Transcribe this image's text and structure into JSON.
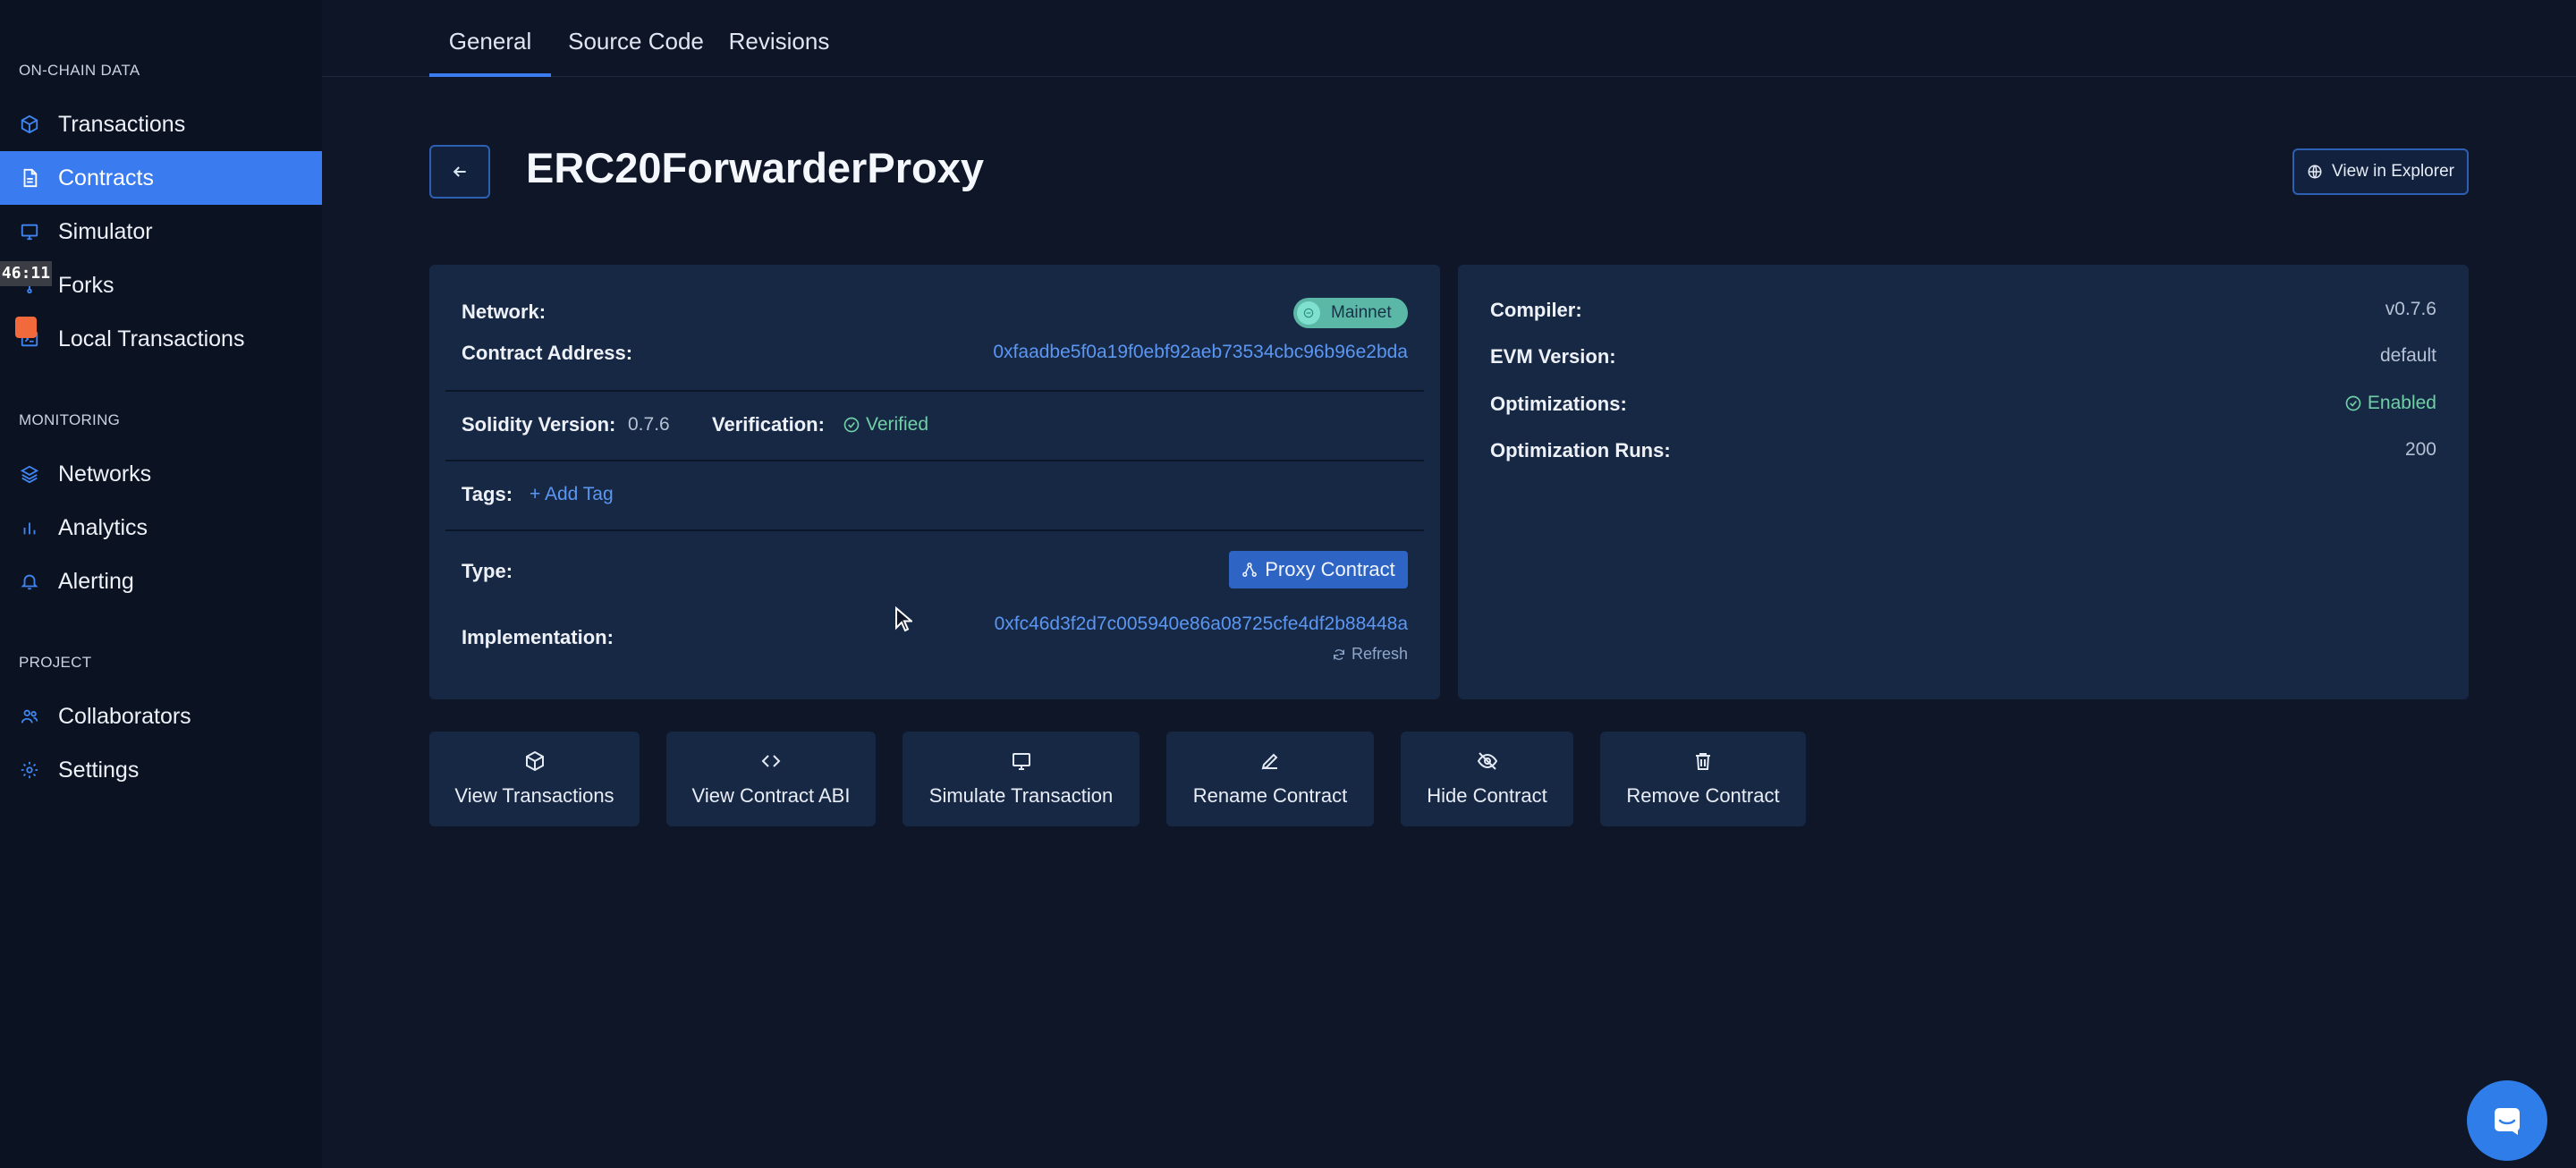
{
  "sidebar": {
    "sections": [
      {
        "title": "ON-CHAIN DATA",
        "items": [
          {
            "label": "Transactions",
            "icon": "cube-icon"
          },
          {
            "label": "Contracts",
            "icon": "document-icon",
            "active": true
          },
          {
            "label": "Simulator",
            "icon": "monitor-icon"
          },
          {
            "label": "Forks",
            "icon": "fork-icon"
          },
          {
            "label": "Local Transactions",
            "icon": "terminal-icon"
          }
        ]
      },
      {
        "title": "MONITORING",
        "items": [
          {
            "label": "Networks",
            "icon": "layers-icon"
          },
          {
            "label": "Analytics",
            "icon": "bar-chart-icon"
          },
          {
            "label": "Alerting",
            "icon": "bell-icon"
          }
        ]
      },
      {
        "title": "PROJECT",
        "items": [
          {
            "label": "Collaborators",
            "icon": "users-icon"
          },
          {
            "label": "Settings",
            "icon": "gear-icon"
          }
        ]
      }
    ],
    "recording_timer": "46:11"
  },
  "tabs": [
    {
      "label": "General",
      "active": true
    },
    {
      "label": "Source Code"
    },
    {
      "label": "Revisions"
    }
  ],
  "header": {
    "title": "ERC20ForwarderProxy",
    "explorer_label": "View in Explorer"
  },
  "contract": {
    "network_label": "Network:",
    "network_value": "Mainnet",
    "address_label": "Contract Address:",
    "address_value": "0xfaadbe5f0a19f0ebf92aeb73534cbc96b96e2bda",
    "solidity_label": "Solidity Version:",
    "solidity_value": "0.7.6",
    "verification_label": "Verification:",
    "verification_value": "Verified",
    "tags_label": "Tags:",
    "add_tag_label": "+ Add Tag",
    "type_label": "Type:",
    "type_value": "Proxy Contract",
    "implementation_label": "Implementation:",
    "implementation_value": "0xfc46d3f2d7c005940e86a08725cfe4df2b88448a",
    "refresh_label": "Refresh"
  },
  "compiler": {
    "compiler_label": "Compiler:",
    "compiler_value": "v0.7.6",
    "evm_label": "EVM Version:",
    "evm_value": "default",
    "optimizations_label": "Optimizations:",
    "optimizations_value": "Enabled",
    "runs_label": "Optimization Runs:",
    "runs_value": "200"
  },
  "actions": [
    {
      "label": "View Transactions",
      "icon": "cube-icon"
    },
    {
      "label": "View Contract ABI",
      "icon": "code-icon"
    },
    {
      "label": "Simulate Transaction",
      "icon": "monitor-icon"
    },
    {
      "label": "Rename Contract",
      "icon": "pencil-icon"
    },
    {
      "label": "Hide Contract",
      "icon": "eye-off-icon"
    },
    {
      "label": "Remove Contract",
      "icon": "trash-icon"
    }
  ],
  "colors": {
    "accent": "#3a7bf0",
    "background": "#0e1628",
    "card": "#172845",
    "success": "#6fd0a6",
    "link": "#5b97f2"
  }
}
